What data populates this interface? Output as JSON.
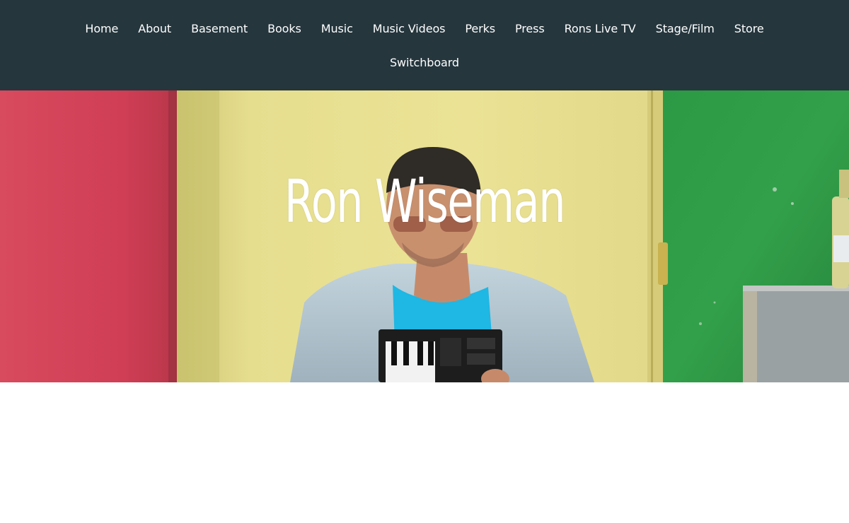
{
  "nav": {
    "items": [
      {
        "label": "Home"
      },
      {
        "label": "About"
      },
      {
        "label": "Basement"
      },
      {
        "label": "Books"
      },
      {
        "label": "Music"
      },
      {
        "label": "Music Videos"
      },
      {
        "label": "Perks"
      },
      {
        "label": "Press"
      },
      {
        "label": "Rons Live TV"
      },
      {
        "label": "Stage/Film"
      },
      {
        "label": "Store"
      },
      {
        "label": "Switchboard"
      }
    ]
  },
  "hero": {
    "title": "Ron Wiseman"
  },
  "colors": {
    "header_bg": "#25363d",
    "text": "#ffffff",
    "wall_red": "#d6435a",
    "wall_yellow": "#e9de8c",
    "wall_green": "#2f9a44"
  }
}
